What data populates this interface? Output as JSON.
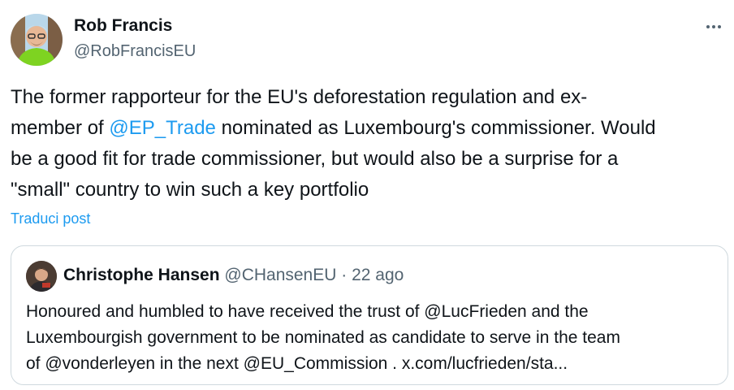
{
  "tweet": {
    "author_name": "Rob Francis",
    "author_handle": "@RobFrancisEU",
    "text": {
      "line1": "The former rapporteur for the EU's deforestation regulation and ex-",
      "line2_pre": "member of ",
      "line2_mention": "@EP_Trade",
      "line2_post": " nominated as Luxembourg's commissioner. Would",
      "line3": "be a good fit for trade commissioner, but would also be a surprise for a",
      "line4": "\"small\" country to win such a key portfolio"
    },
    "translate_label": "Traduci post"
  },
  "quote": {
    "author_name": "Christophe Hansen",
    "author_handle": "@CHansenEU",
    "separator": " · ",
    "time": "22 ago",
    "text": {
      "line1": "Honoured and humbled to have received the trust of @LucFrieden and the",
      "line2": "Luxembourgish government to be nominated as candidate to serve in the team",
      "line3": "of @vonderleyen in the next @EU_Commission . x.com/lucfrieden/sta..."
    }
  },
  "colors": {
    "link": "#1d9bf0",
    "secondary_text": "#536471",
    "primary_text": "#0f1419",
    "border": "#cfd9de"
  },
  "icons": {
    "more": "more-horizontal-icon"
  }
}
